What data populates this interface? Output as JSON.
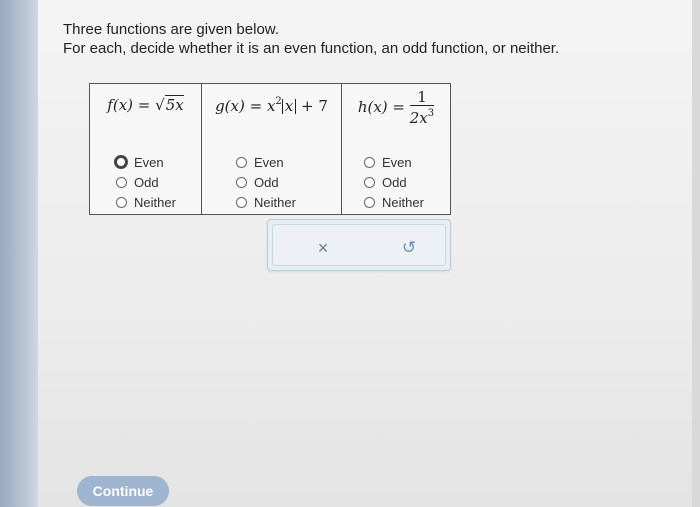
{
  "prompt": {
    "line1": "Three functions are given below.",
    "line2": "For each, decide whether it is an even function, an odd function, or neither."
  },
  "functions": [
    {
      "lhs": "f(x) = ",
      "radicand": "5x",
      "options": [
        "Even",
        "Odd",
        "Neither"
      ],
      "selected": "Even"
    },
    {
      "lhs": "g(x) = x",
      "power": "2",
      "abs": "x",
      "tail": " + 7",
      "options": [
        "Even",
        "Odd",
        "Neither"
      ],
      "selected": null
    },
    {
      "lhs": "h(x) = ",
      "numerator": "1",
      "denominator": "2x",
      "power": "3",
      "options": [
        "Even",
        "Odd",
        "Neither"
      ],
      "selected": null
    }
  ],
  "actions": {
    "clear_icon": "close-icon",
    "clear_label": "×",
    "undo_icon": "undo-icon",
    "undo_label": "↺"
  },
  "continue_label": "Continue",
  "colors": {
    "continue_button": "#9eb4cf",
    "action_box": "#e9eef3",
    "left_bar": "#9aa9bf"
  }
}
